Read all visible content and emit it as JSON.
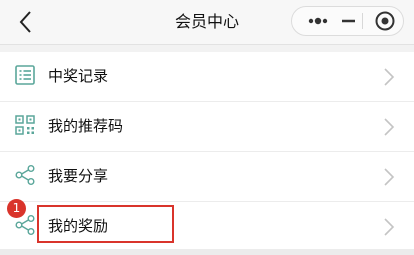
{
  "navbar": {
    "title": "会员中心",
    "back_icon": "chevron-left-icon",
    "more_icon": "more-dots-icon",
    "minimize_icon": "minimize-icon",
    "close_icon": "target-close-icon"
  },
  "menu": {
    "items": [
      {
        "label": "中奖记录",
        "icon": "list-icon"
      },
      {
        "label": "我的推荐码",
        "icon": "qr-code-icon"
      },
      {
        "label": "我要分享",
        "icon": "share-icon"
      },
      {
        "label": "我的奖励",
        "icon": "share-icon"
      }
    ]
  },
  "annotation": {
    "badge": "1",
    "color": "#d9342b"
  },
  "colors": {
    "icon": "#5aa69a",
    "arrow": "#c4c4c4"
  }
}
